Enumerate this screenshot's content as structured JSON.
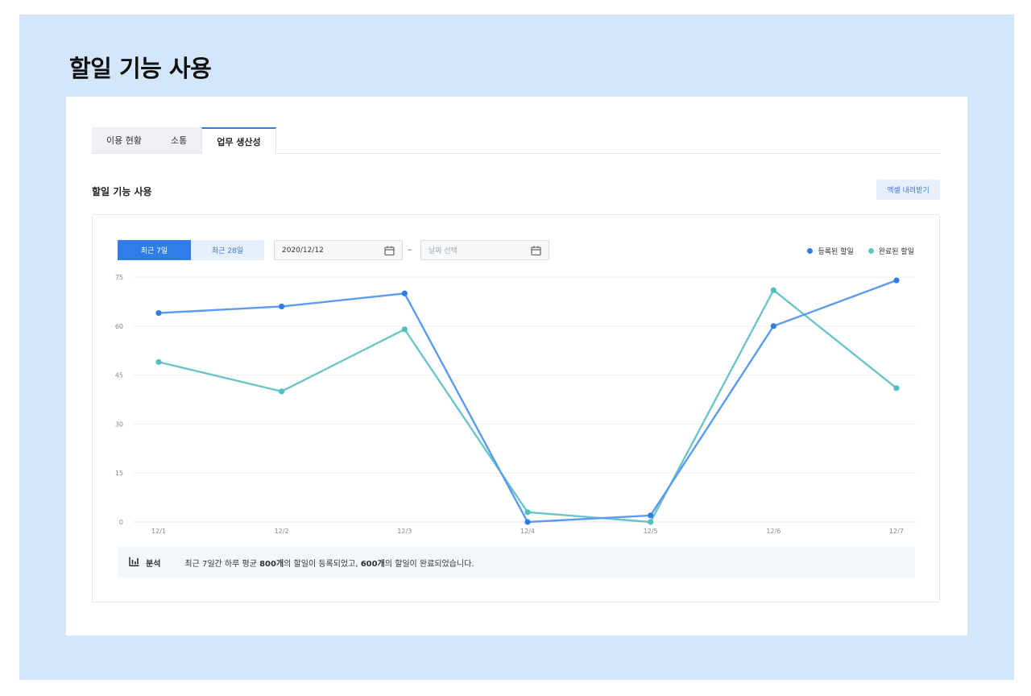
{
  "page": {
    "title": "할일 기능 사용"
  },
  "tabs": [
    {
      "label": "이용 현황",
      "active": false
    },
    {
      "label": "소통",
      "active": false
    },
    {
      "label": "업무 생산성",
      "active": true
    }
  ],
  "section": {
    "title": "할일 기능 사용",
    "excel_label": "엑셀 내려받기"
  },
  "range": {
    "recent7": "최근 7일",
    "recent28": "최근 28일"
  },
  "dates": {
    "start_value": "2020/12/12",
    "separator": "–",
    "end_placeholder": "날짜 선택"
  },
  "icons": {
    "calendar": "calendar-icon",
    "chart": "bar-chart-icon"
  },
  "colors": {
    "accent": "#2e7de9",
    "registered": "#5b9bef",
    "completed": "#6cc4c8"
  },
  "chart_data": {
    "type": "line",
    "x": [
      "12/1",
      "12/2",
      "12/3",
      "12/4",
      "12/5",
      "12/6",
      "12/7"
    ],
    "ylim": [
      0,
      75
    ],
    "yticks": [
      "0",
      "15",
      "30",
      "45",
      "60",
      "75"
    ],
    "grid": true,
    "legend_placement": "top-right",
    "series": [
      {
        "name": "등록된 할일",
        "values": [
          64,
          66,
          70,
          0,
          2,
          60,
          74
        ]
      },
      {
        "name": "완료된 할일",
        "values": [
          49,
          40,
          59,
          3,
          0,
          71,
          41
        ]
      }
    ]
  },
  "analysis": {
    "label": "분석",
    "t1": "최근 7일간 하루 평균 ",
    "b1": "800개",
    "t2": "의 할일이 등록되었고, ",
    "b2": "600개",
    "t3": "의 할일이 완료되었습니다."
  }
}
